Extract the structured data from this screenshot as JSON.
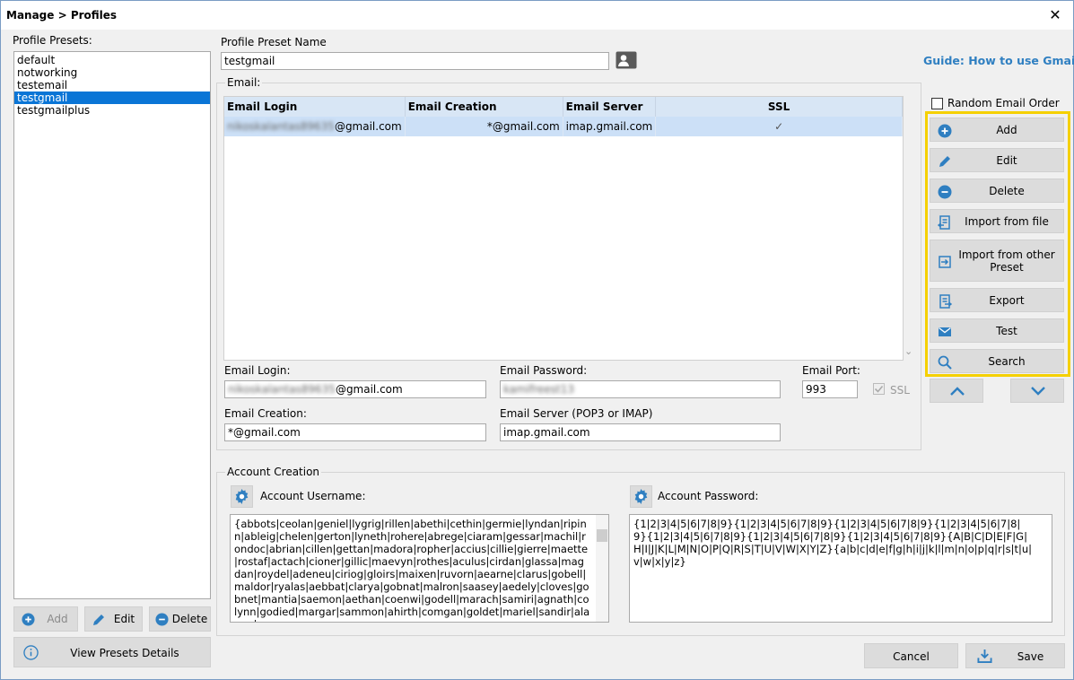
{
  "window": {
    "title": "Manage > Profiles",
    "close": "✕"
  },
  "presets": {
    "label": "Profile Presets:",
    "items": [
      "default",
      "notworking",
      "testemail",
      "testgmail",
      "testgmailplus"
    ],
    "selected_index": 3,
    "add": "Add",
    "edit": "Edit",
    "delete": "Delete",
    "view_details": "View Presets Details"
  },
  "preset_name": {
    "label": "Profile Preset Name",
    "value": "testgmail"
  },
  "guide_link": "Guide: How to use Gmails",
  "email_group": {
    "title": "Email:",
    "columns": [
      "Email Login",
      "Email Creation",
      "Email Server",
      "SSL"
    ],
    "rows": [
      {
        "login_blurred": "nikoskalantas89635",
        "login_domain": "@gmail.com",
        "creation": "*@gmail.com",
        "server": "imap.gmail.com",
        "ssl": "✓"
      }
    ],
    "random_order_label": "Random Email Order",
    "actions": [
      "Add",
      "Edit",
      "Delete",
      "Import from file",
      "Import from other Preset",
      "Export",
      "Test",
      "Search"
    ],
    "up": "⌃",
    "down": "⌄"
  },
  "email_form": {
    "login_label": "Email Login:",
    "login_blurred": "nikoskalantas89635",
    "login_domain": "@gmail.com",
    "password_label": "Email Password:",
    "password_blurred": "kamifreest13",
    "port_label": "Email Port:",
    "port_value": "993",
    "ssl_label": "SSL",
    "creation_label": "Email Creation:",
    "creation_value": "*@gmail.com",
    "server_label": "Email Server (POP3 or IMAP)",
    "server_value": "imap.gmail.com"
  },
  "account_creation": {
    "title": "Account Creation",
    "username_label": "Account Username:",
    "username_value": "{abbots|ceolan|geniel|lygrig|rillen|abethi|cethin|germie|lyndan|ripinn|ableig|chelen|gerton|lyneth|rohere|abrege|ciaram|gessar|machil|rondoc|abrian|cillen|gettan|madora|ropher|accius|cillie|gierre|maette|rostaf|actach|cioner|gillic|maevyn|rothes|aculus|cirdan|glassa|magdan|roydel|adeneu|ciriog|gloirs|maixen|ruvorn|aearne|clarus|gobell|maldor|ryalas|aebbat|clarya|gobnat|malron|saasey|aedely|cloves|gobnet|mantia|saemon|aethan|coenwi|godell|marach|samiri|agnath|colynn|godied|margar|sammon|ahirth|comgan|goldet|mariel|sandir|alanna|",
    "password_label": "Account Password:",
    "password_value": "{1|2|3|4|5|6|7|8|9}{1|2|3|4|5|6|7|8|9}{1|2|3|4|5|6|7|8|9}{1|2|3|4|5|6|7|8|9}{1|2|3|4|5|6|7|8|9}{1|2|3|4|5|6|7|8|9}{1|2|3|4|5|6|7|8|9}{A|B|C|D|E|F|G|H|I|J|K|L|M|N|O|P|Q|R|S|T|U|V|W|X|Y|Z}{a|b|c|d|e|f|g|h|i|j|k|l|m|n|o|p|q|r|s|t|u|v|w|x|y|z}"
  },
  "footer": {
    "cancel": "Cancel",
    "save": "Save"
  },
  "colors": {
    "accent": "#2f7fc1",
    "highlight": "#f5d000",
    "selection": "#0a75d6"
  }
}
